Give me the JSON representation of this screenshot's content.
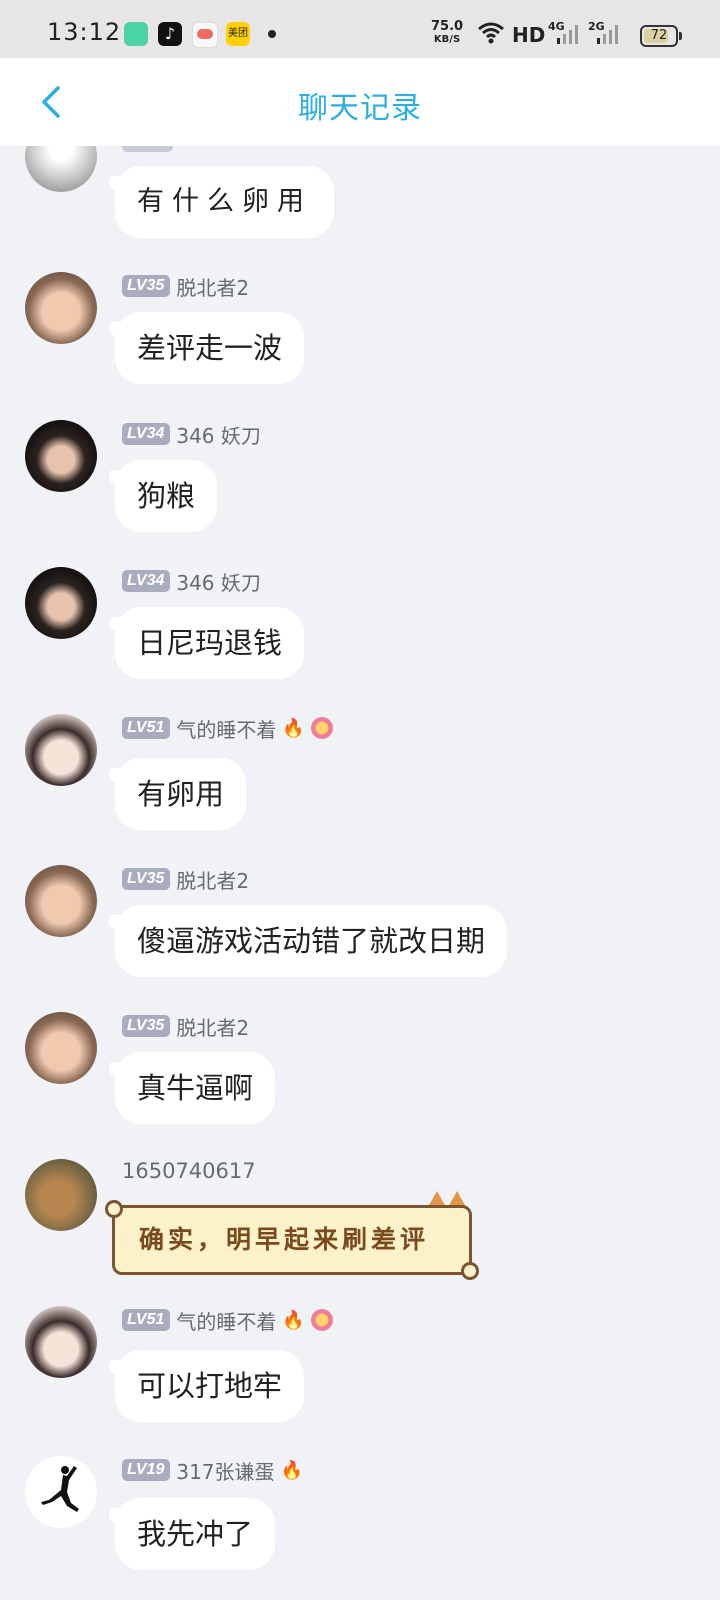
{
  "status_bar": {
    "time": "13:12",
    "apps": [
      {
        "name": "notes-app-icon",
        "color": "#4cd3a5"
      },
      {
        "name": "tiktok-icon",
        "color": "#111111"
      },
      {
        "name": "game-app-icon",
        "color": "#f06a5d"
      },
      {
        "name": "meituan-icon",
        "color": "#ffd100",
        "label": "美团"
      }
    ],
    "net_speed": "75.0",
    "net_speed_unit": "KB/S",
    "hd": "HD",
    "net_4g": "4G",
    "net_2g": "2G",
    "battery": "72"
  },
  "header": {
    "title": "聊天记录",
    "back_icon": "chevron-left-icon",
    "accent": "#2baee5"
  },
  "messages": [
    {
      "name": "",
      "level": "",
      "text": "有什么卵用",
      "style": "hand"
    },
    {
      "name": "脱北者2",
      "level": "LV35",
      "text": "差评走一波"
    },
    {
      "name": "346  妖刀",
      "level": "LV34",
      "text": "狗粮"
    },
    {
      "name": "346  妖刀",
      "level": "LV34",
      "text": "日尼玛退钱"
    },
    {
      "name": "气的睡不着",
      "level": "LV51",
      "text": "有卵用",
      "badges": [
        "fire",
        "flower"
      ]
    },
    {
      "name": "脱北者2",
      "level": "LV35",
      "text": "傻逼游戏活动错了就改日期"
    },
    {
      "name": "脱北者2",
      "level": "LV35",
      "text": "真牛逼啊"
    },
    {
      "name": "1650740617",
      "level": "",
      "text": "确实，明早起来刷差评",
      "style": "scroll"
    },
    {
      "name": "气的睡不着",
      "level": "LV51",
      "text": "可以打地牢",
      "badges": [
        "fire",
        "flower"
      ]
    },
    {
      "name": "317张谦蛋",
      "level": "LV19",
      "text": "我先冲了",
      "badges": [
        "fire"
      ]
    }
  ],
  "colors": {
    "background": "#f1f2f6",
    "bubble": "#ffffff",
    "level_badge": "#a7adbf"
  }
}
